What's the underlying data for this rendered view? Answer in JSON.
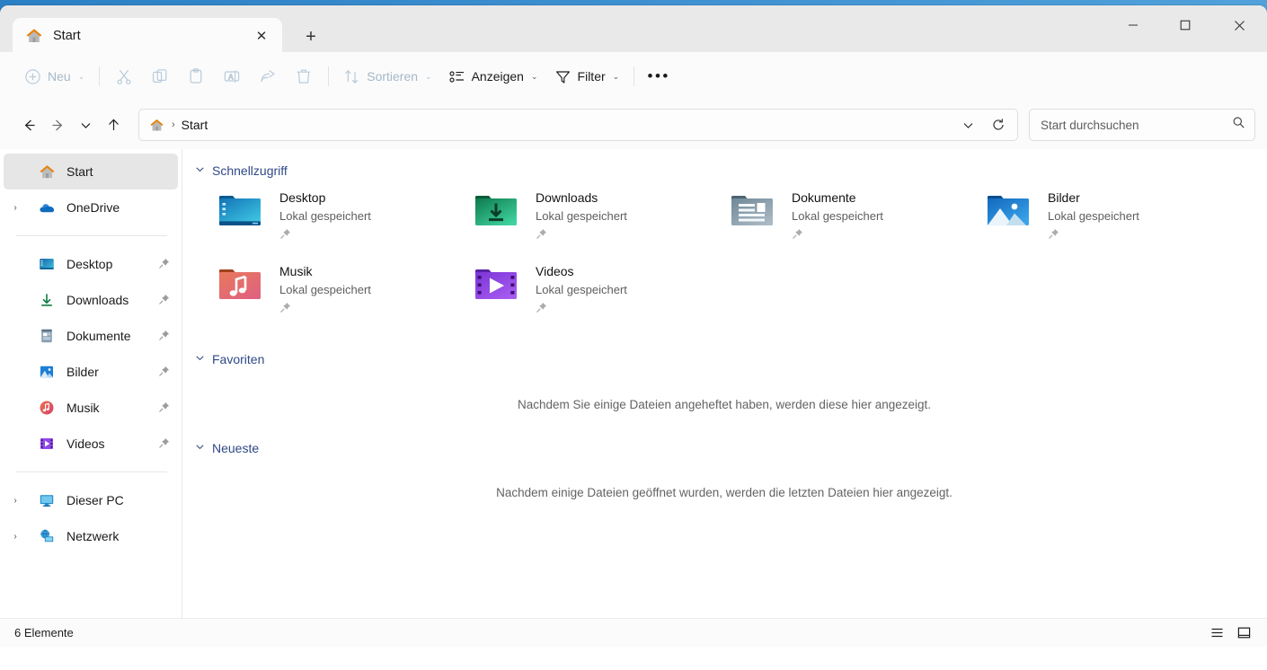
{
  "window": {
    "tab_label": "Start",
    "tab_icon": "home-icon",
    "close_tab_glyph": "✕",
    "new_tab_glyph": "+",
    "minimize_glyph": "–",
    "maximize_glyph": "□",
    "close_glyph": "✕"
  },
  "toolbar": {
    "new_label": "Neu",
    "cut_label": "Ausschneiden",
    "copy_label": "Kopieren",
    "paste_label": "Einfügen",
    "rename_label": "Umbenennen",
    "share_label": "Freigeben",
    "delete_label": "Löschen",
    "sort_label": "Sortieren",
    "view_label": "Anzeigen",
    "filter_label": "Filter",
    "more_glyph": "•••",
    "chevron": "⌄"
  },
  "navbar": {
    "back_glyph": "←",
    "forward_glyph": "→",
    "recent_glyph": "⌄",
    "up_glyph": "↑",
    "breadcrumb_icon": "home-icon",
    "breadcrumb_separator": "›",
    "breadcrumb_label": "Start",
    "dropdown_glyph": "⌄",
    "refresh_glyph": "⟳"
  },
  "search": {
    "placeholder": "Start durchsuchen",
    "icon": "search-icon"
  },
  "sidebar": {
    "items": [
      {
        "label": "Start",
        "icon": "home-icon",
        "expandable": false,
        "selected": true,
        "pinned": false
      },
      {
        "label": "OneDrive",
        "icon": "cloud-icon",
        "expandable": true,
        "selected": false,
        "pinned": false
      }
    ],
    "pinned_items": [
      {
        "label": "Desktop",
        "icon": "desktop-folder-icon",
        "pinned": true
      },
      {
        "label": "Downloads",
        "icon": "downloads-icon",
        "pinned": true
      },
      {
        "label": "Dokumente",
        "icon": "documents-icon",
        "pinned": true
      },
      {
        "label": "Bilder",
        "icon": "pictures-icon",
        "pinned": true
      },
      {
        "label": "Musik",
        "icon": "music-icon",
        "pinned": true
      },
      {
        "label": "Videos",
        "icon": "videos-icon",
        "pinned": true
      }
    ],
    "system_items": [
      {
        "label": "Dieser PC",
        "icon": "this-pc-icon",
        "expandable": true
      },
      {
        "label": "Netzwerk",
        "icon": "network-icon",
        "expandable": true
      }
    ],
    "expand_glyph": "›"
  },
  "main": {
    "sections": [
      {
        "title": "Schnellzugriff",
        "chevron": "⌄"
      },
      {
        "title": "Favoriten",
        "chevron": "⌄"
      },
      {
        "title": "Neueste",
        "chevron": "⌄"
      }
    ],
    "quick_access": [
      {
        "name": "Desktop",
        "subtitle": "Lokal gespeichert",
        "icon": "desktop-folder-icon",
        "pinned": true
      },
      {
        "name": "Downloads",
        "subtitle": "Lokal gespeichert",
        "icon": "downloads-folder-icon",
        "pinned": true
      },
      {
        "name": "Dokumente",
        "subtitle": "Lokal gespeichert",
        "icon": "documents-folder-icon",
        "pinned": true
      },
      {
        "name": "Bilder",
        "subtitle": "Lokal gespeichert",
        "icon": "pictures-folder-icon",
        "pinned": true
      },
      {
        "name": "Musik",
        "subtitle": "Lokal gespeichert",
        "icon": "music-folder-icon",
        "pinned": true
      },
      {
        "name": "Videos",
        "subtitle": "Lokal gespeichert",
        "icon": "videos-folder-icon",
        "pinned": true
      }
    ],
    "favorites_empty": "Nachdem Sie einige Dateien angeheftet haben, werden diese hier angezeigt.",
    "recent_empty": "Nachdem einige Dateien geöffnet wurden, werden die letzten Dateien hier angezeigt."
  },
  "statusbar": {
    "item_count": "6 Elemente",
    "list_view_icon": "list-view-icon",
    "details_view_icon": "details-view-icon"
  },
  "colors": {
    "accent_blue": "#0078d4",
    "section_header": "#2f4886",
    "disabled": "#b9cbdb",
    "selected_nav": "#e6e6e6"
  }
}
